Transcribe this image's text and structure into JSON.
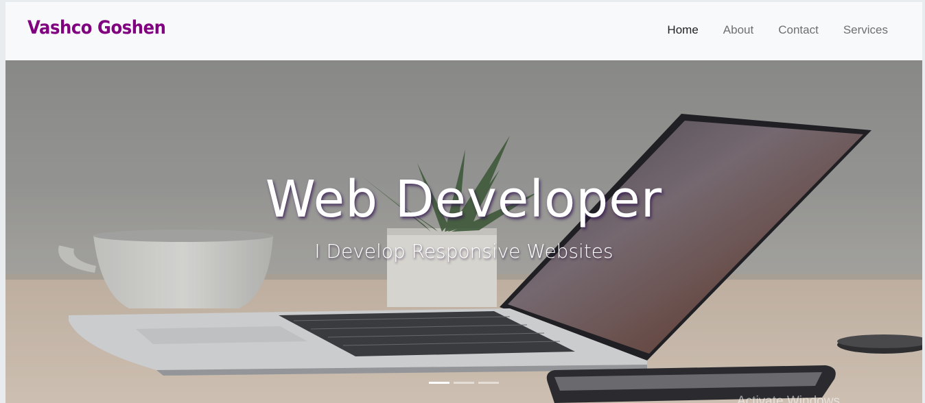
{
  "brand": "Vashco Goshen",
  "nav": {
    "home": "Home",
    "about": "About",
    "contact": "Contact",
    "services": "Services",
    "active": "Home"
  },
  "hero": {
    "title": "Web Developer",
    "subtitle": "I Develop Responsive Websites",
    "slides_count": 3,
    "active_slide": 1
  },
  "watermark": "Activate Windows",
  "colors": {
    "brand": "#800080",
    "nav_text": "#6f6f6f",
    "nav_active": "#222222",
    "navbar_bg": "#f8f9fa"
  }
}
